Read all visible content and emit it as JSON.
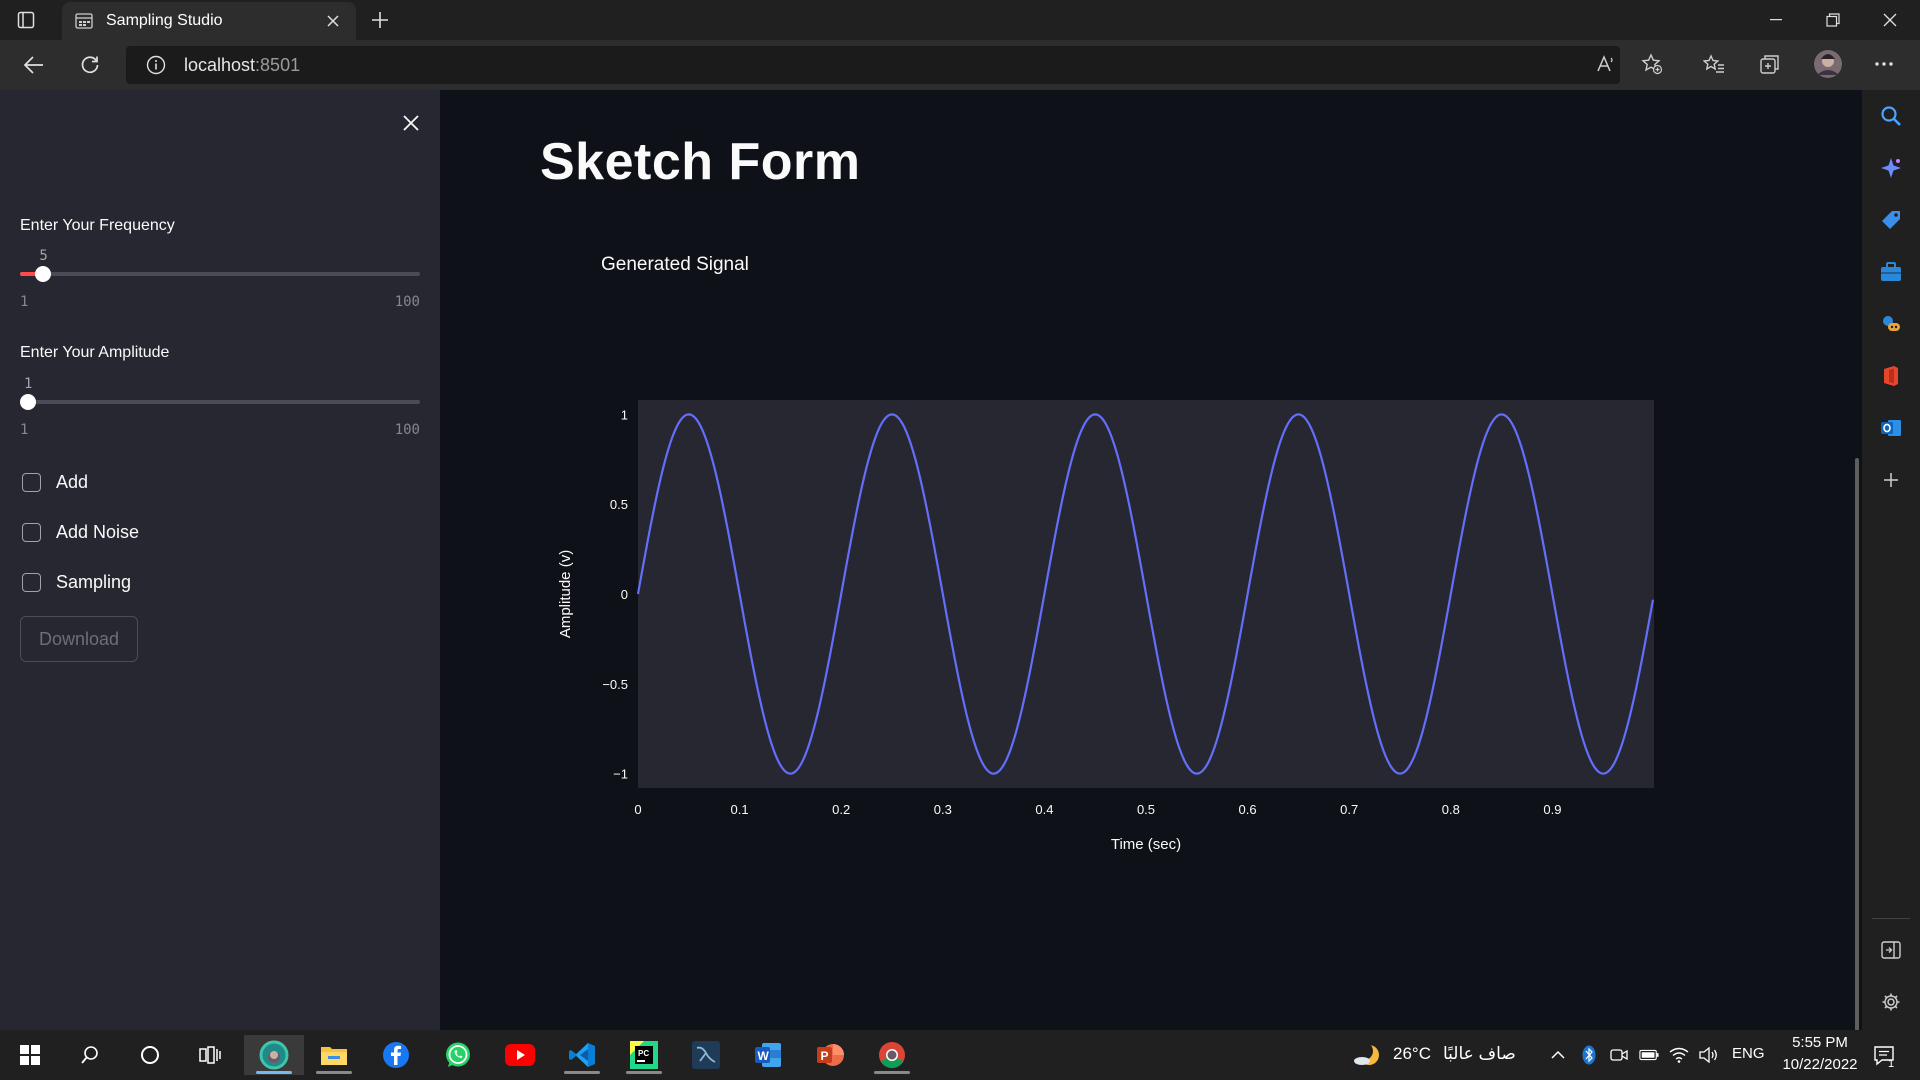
{
  "browser": {
    "tab_title": "Sampling Studio",
    "url_host": "localhost",
    "url_port": ":8501"
  },
  "sidebar": {
    "frequency": {
      "label": "Enter Your Frequency",
      "value": "5",
      "min": "1",
      "max": "100",
      "fraction": 0.04
    },
    "amplitude": {
      "label": "Enter Your Amplitude",
      "value": "1",
      "min": "1",
      "max": "100",
      "fraction": 0.0
    },
    "checkboxes": [
      {
        "label": "Add",
        "checked": false
      },
      {
        "label": "Add Noise",
        "checked": false
      },
      {
        "label": "Sampling",
        "checked": false
      }
    ],
    "download_label": "Download"
  },
  "main": {
    "title": "Sketch Form"
  },
  "chart_data": {
    "type": "line",
    "title": "Generated Signal",
    "xlabel": "Time (sec)",
    "ylabel": "Amplitude (v)",
    "xlim": [
      0,
      1
    ],
    "ylim": [
      -1.08,
      1.08
    ],
    "xticks": [
      "0",
      "0.1",
      "0.2",
      "0.3",
      "0.4",
      "0.5",
      "0.6",
      "0.7",
      "0.8",
      "0.9"
    ],
    "xtick_values": [
      0,
      0.1,
      0.2,
      0.3,
      0.4,
      0.5,
      0.6,
      0.7,
      0.8,
      0.9
    ],
    "yticks": [
      "1",
      "0.5",
      "0",
      "−0.5",
      "−1"
    ],
    "ytick_values": [
      1,
      0.5,
      0,
      -0.5,
      -1
    ],
    "series": [
      {
        "function": "amplitude*sin(2*pi*frequency*t)",
        "frequency": 5,
        "amplitude": 1,
        "x_range": [
          0,
          0.999
        ],
        "color": "#636efa"
      }
    ],
    "plot_bg": "#262730",
    "grid": false
  },
  "taskbar": {
    "weather_temp": "26°C",
    "weather_text": "صاف عالبًا",
    "language": "ENG",
    "time": "5:55 PM",
    "date": "10/22/2022",
    "notification_count": "1"
  },
  "colors": {
    "accent": "#ff4b4b",
    "line": "#636efa",
    "background": "#0e1117",
    "sidebar": "#262730"
  }
}
